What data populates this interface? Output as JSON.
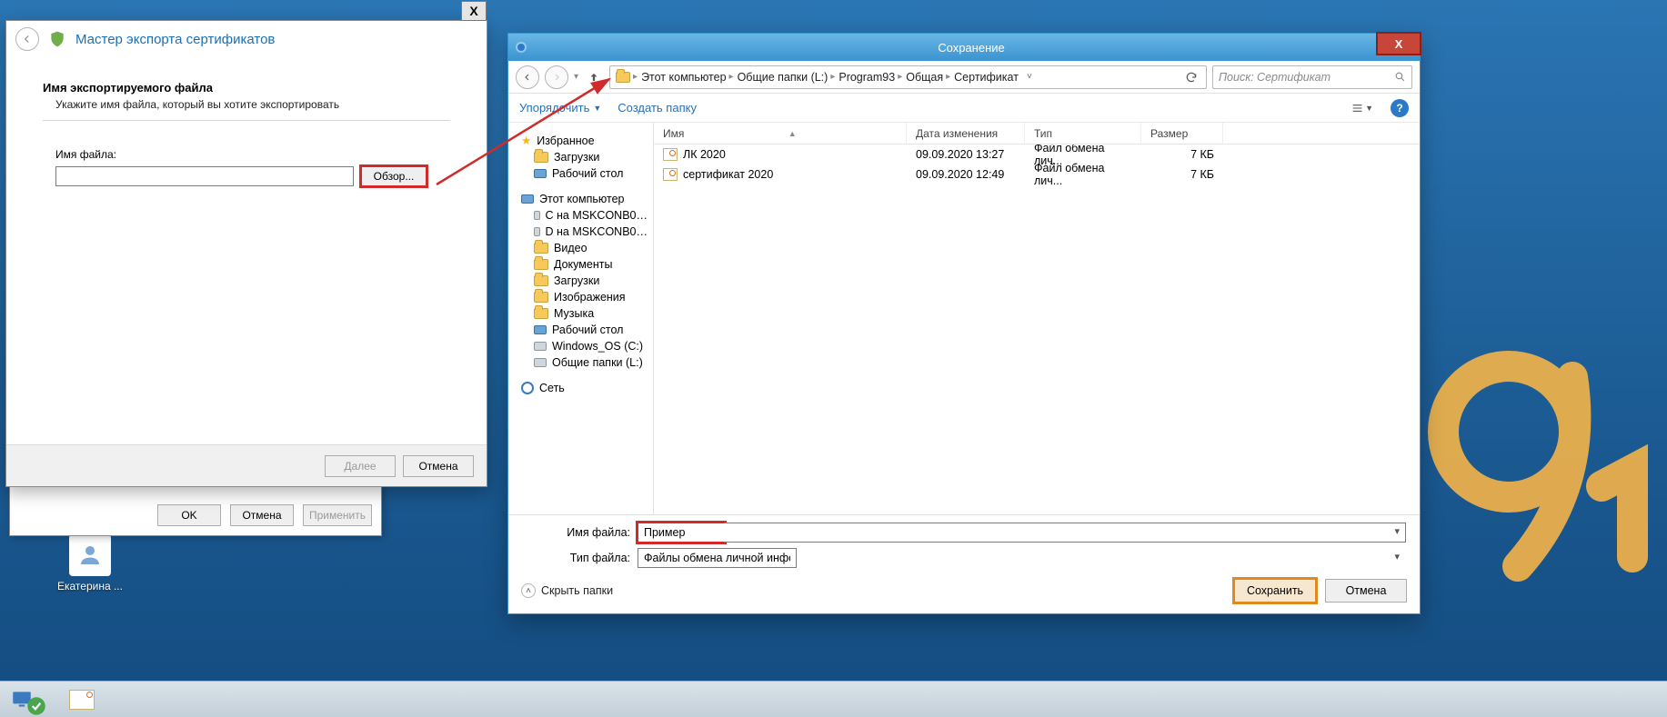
{
  "desktop": {
    "icon_label": "Екатерина ..."
  },
  "wizard": {
    "title": "Мастер экспорта сертификатов",
    "close_x": "X",
    "heading": "Имя экспортируемого файла",
    "subtext": "Укажите имя файла, который вы хотите экспортировать",
    "filename_label": "Имя файла:",
    "filename_value": "",
    "browse": "Обзор...",
    "next": "Далее",
    "cancel": "Отмена"
  },
  "parent_dialog": {
    "ok": "OK",
    "cancel": "Отмена",
    "apply": "Применить"
  },
  "save": {
    "title": "Сохранение",
    "close_x": "X",
    "breadcrumb": [
      "Этот компьютер",
      "Общие папки (L:)",
      "Program93",
      "Общая",
      "Сертификат"
    ],
    "search_placeholder": "Поиск: Сертификат",
    "toolbar": {
      "organize": "Упорядочить",
      "new_folder": "Создать папку"
    },
    "columns": {
      "name": "Имя",
      "date": "Дата изменения",
      "type": "Тип",
      "size": "Размер"
    },
    "tree": {
      "favorites": "Избранное",
      "fav_items": [
        "Загрузки",
        "Рабочий стол"
      ],
      "this_pc": "Этот компьютер",
      "pc_items": [
        "C на MSKCONB0…",
        "D на MSKCONB0…",
        "Видео",
        "Документы",
        "Загрузки",
        "Изображения",
        "Музыка",
        "Рабочий стол",
        "Windows_OS (C:)",
        "Общие папки (L:)"
      ],
      "network": "Сеть"
    },
    "files": [
      {
        "name": "ЛК 2020",
        "date": "09.09.2020 13:27",
        "type": "Файл обмена лич...",
        "size": "7 КБ"
      },
      {
        "name": "сертификат 2020",
        "date": "09.09.2020 12:49",
        "type": "Файл обмена лич...",
        "size": "7 КБ"
      }
    ],
    "filename_label": "Имя файла:",
    "filename_value": "Пример",
    "filetype_label": "Тип файла:",
    "filetype_value": "Файлы обмена личной информацией (*.pfx)",
    "hide_folders": "Скрыть папки",
    "save_btn": "Сохранить",
    "cancel_btn": "Отмена"
  }
}
